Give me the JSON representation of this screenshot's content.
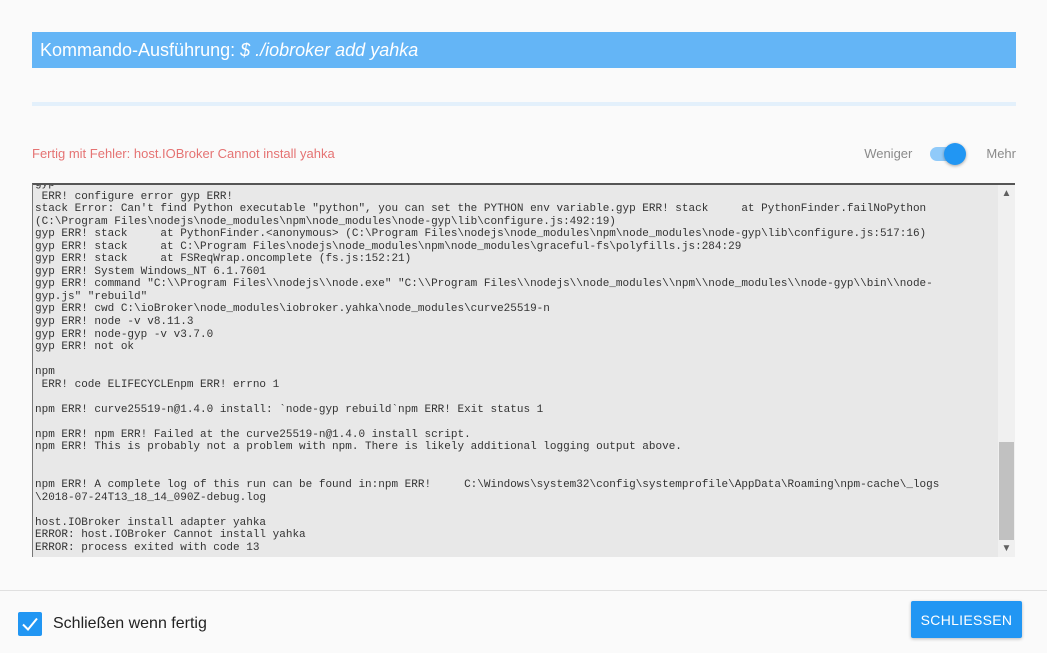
{
  "title": {
    "prefix": "Kommando-Ausführung: ",
    "command": "$ ./iobroker add yahka"
  },
  "status": {
    "text": "Fertig mit Fehler: host.IOBroker Cannot install yahka",
    "color": "#e57373"
  },
  "detail_toggle": {
    "left_label": "Weniger",
    "right_label": "Mehr",
    "state": "on"
  },
  "log": {
    "text": "gyp\n ERR! configure error gyp ERR!\nstack Error: Can't find Python executable \"python\", you can set the PYTHON env variable.gyp ERR! stack     at PythonFinder.failNoPython\n(C:\\Program Files\\nodejs\\node_modules\\npm\\node_modules\\node-gyp\\lib\\configure.js:492:19)\ngyp ERR! stack     at PythonFinder.<anonymous> (C:\\Program Files\\nodejs\\node_modules\\npm\\node_modules\\node-gyp\\lib\\configure.js:517:16)\ngyp ERR! stack     at C:\\Program Files\\nodejs\\node_modules\\npm\\node_modules\\graceful-fs\\polyfills.js:284:29\ngyp ERR! stack     at FSReqWrap.oncomplete (fs.js:152:21)\ngyp ERR! System Windows_NT 6.1.7601\ngyp ERR! command \"C:\\\\Program Files\\\\nodejs\\\\node.exe\" \"C:\\\\Program Files\\\\nodejs\\\\node_modules\\\\npm\\\\node_modules\\\\node-gyp\\\\bin\\\\node-\ngyp.js\" \"rebuild\"\ngyp ERR! cwd C:\\ioBroker\\node_modules\\iobroker.yahka\\node_modules\\curve25519-n\ngyp ERR! node -v v8.11.3\ngyp ERR! node-gyp -v v3.7.0\ngyp ERR! not ok\n\nnpm\n ERR! code ELIFECYCLEnpm ERR! errno 1\n\nnpm ERR! curve25519-n@1.4.0 install: `node-gyp rebuild`npm ERR! Exit status 1\n\nnpm ERR! npm ERR! Failed at the curve25519-n@1.4.0 install script.\nnpm ERR! This is probably not a problem with npm. There is likely additional logging output above.\n\n\nnpm ERR! A complete log of this run can be found in:npm ERR!     C:\\Windows\\system32\\config\\systemprofile\\AppData\\Roaming\\npm-cache\\_logs\n\\2018-07-24T13_18_14_090Z-debug.log\n\nhost.IOBroker install adapter yahka\nERROR: host.IOBroker Cannot install yahka\nERROR: process exited with code 13"
  },
  "footer": {
    "checkbox_label": "Schließen wenn fertig",
    "checkbox_checked": true,
    "close_button_label": "SCHLIESSEN"
  },
  "icons": {
    "scroll_up": "▲",
    "scroll_down": "▼",
    "checkbox": "check-icon"
  },
  "colors": {
    "accent": "#2196f3",
    "title_bar": "#64b5f6",
    "error_text": "#e57373"
  }
}
